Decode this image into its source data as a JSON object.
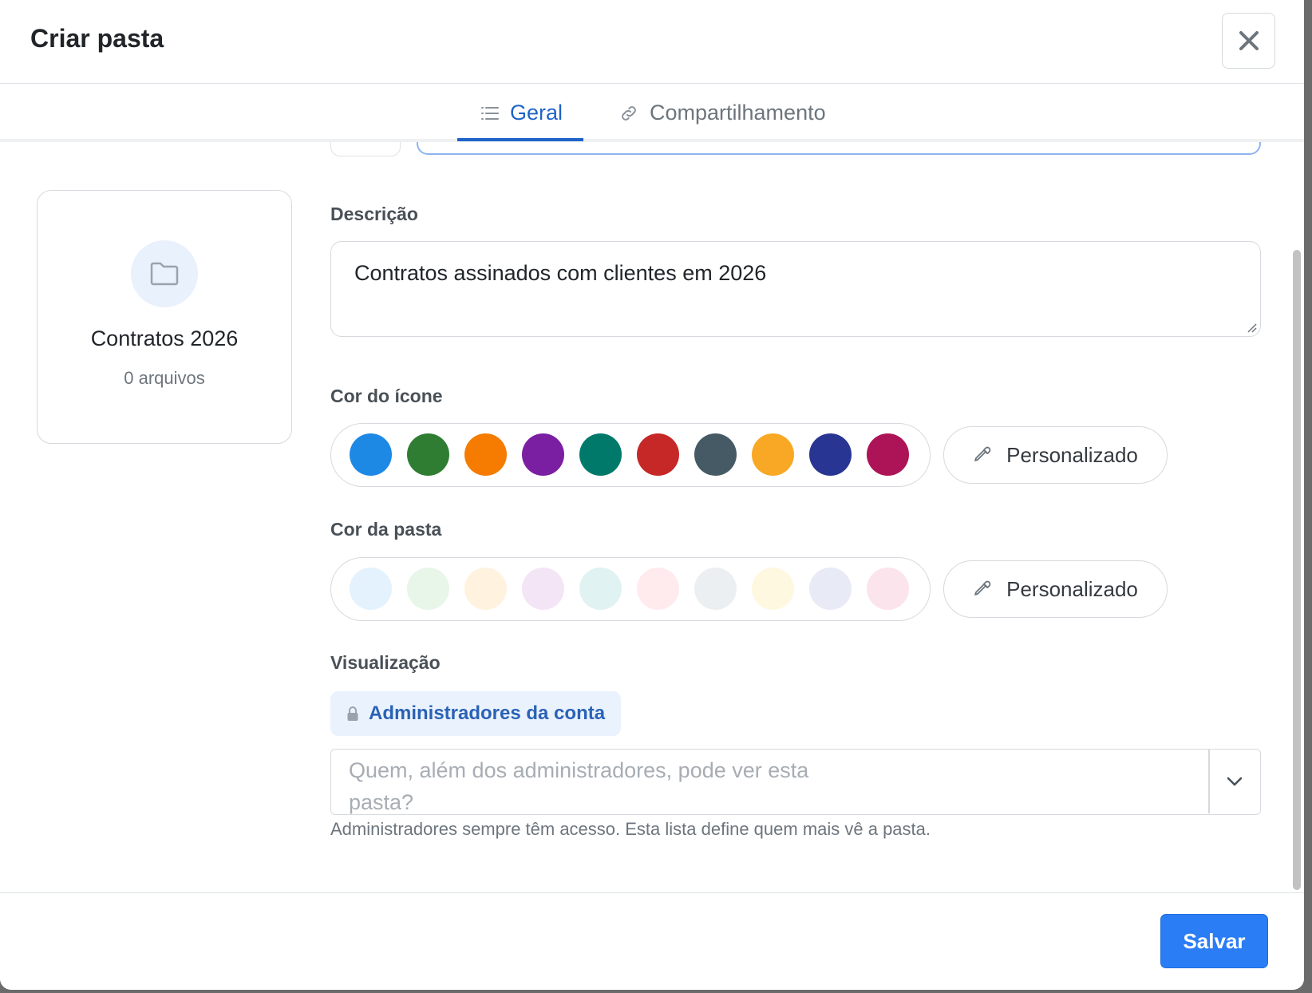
{
  "header": {
    "title": "Criar pasta"
  },
  "tabs": [
    {
      "label": "Geral",
      "icon": "list-icon",
      "active": true
    },
    {
      "label": "Compartilhamento",
      "icon": "link-icon",
      "active": false
    }
  ],
  "preview": {
    "name": "Contratos 2026",
    "count": "0 arquivos",
    "icon": "folder-icon"
  },
  "description": {
    "label": "Descrição",
    "value": "Contratos assinados com clientes em 2026"
  },
  "icon_color": {
    "label": "Cor do ícone",
    "swatches": [
      "#1e88e5",
      "#2e7d32",
      "#f57c00",
      "#7b1fa2",
      "#00796b",
      "#c62828",
      "#455a64",
      "#f9a825",
      "#283593",
      "#ad1457"
    ],
    "custom_label": "Personalizado"
  },
  "folder_color": {
    "label": "Cor da pasta",
    "swatches": [
      "#e3f2fd",
      "#e8f5e9",
      "#fff3e0",
      "#f3e5f5",
      "#e0f2f1",
      "#ffebee",
      "#eceff1",
      "#fff8e1",
      "#e8eaf6",
      "#fce4ec"
    ],
    "custom_label": "Personalizado"
  },
  "visibility": {
    "label": "Visualização",
    "badge": "Administradores da conta",
    "placeholder": "Quem, além dos administradores, pode ver esta pasta?",
    "help": "Administradores sempre têm acesso. Esta lista define quem mais vê a pasta."
  },
  "footer": {
    "save_label": "Salvar"
  },
  "colors": {
    "primary": "#2a7df4",
    "tab_active": "#1f63c7"
  }
}
